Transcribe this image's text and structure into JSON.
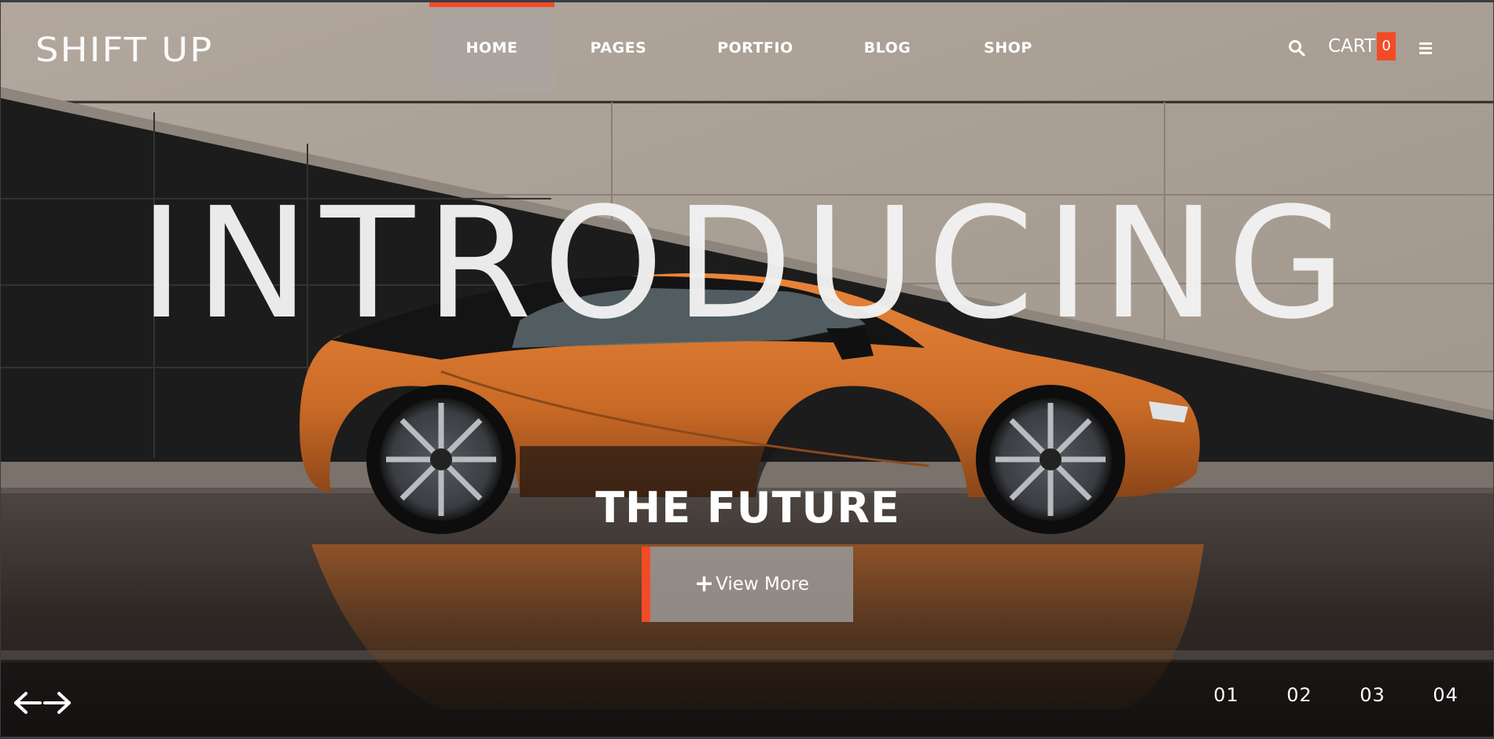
{
  "brand": {
    "logo": "SHIFT UP",
    "accent": "#f24b27"
  },
  "nav": {
    "items": [
      {
        "label": "HOME",
        "active": true
      },
      {
        "label": "PAGES"
      },
      {
        "label": "PORTFIO"
      },
      {
        "label": "BLOG"
      },
      {
        "label": "SHOP"
      }
    ]
  },
  "header_actions": {
    "search_icon": "search-icon",
    "cart_label": "CART",
    "cart_count": "0",
    "menu_icon": "hamburger-menu-icon"
  },
  "hero": {
    "headline": "INTRODUCING",
    "subheadline": "THE FUTURE",
    "cta_icon": "+",
    "cta_label": "View More"
  },
  "slider": {
    "prev_icon": "arrow-left-icon",
    "next_icon": "arrow-right-icon",
    "pages": [
      "01",
      "02",
      "03",
      "04"
    ]
  }
}
